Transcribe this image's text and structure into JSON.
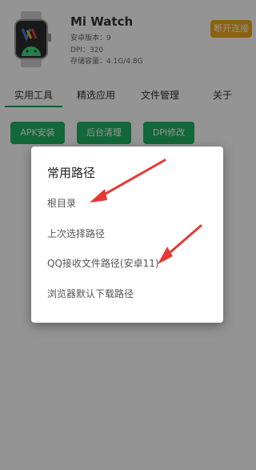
{
  "header": {
    "device_name": "Mi Watch",
    "info": [
      "安卓版本：9",
      "DPI：320",
      "存储容量：4.1G/4.8G"
    ],
    "connect_button": "断开连接"
  },
  "tabs": [
    "实用工具",
    "精选应用",
    "文件管理",
    "关于"
  ],
  "tools": [
    "APK安装",
    "后台清理",
    "DPI修改"
  ],
  "dialog": {
    "title": "常用路径",
    "items": [
      "根目录",
      "上次选择路径",
      "QQ接收文件路径(安卓11)",
      "浏览器默认下载路径"
    ]
  },
  "colors": {
    "accent_green": "#20b463",
    "connect_orange": "#f0a81a",
    "annotation_red": "#e53935"
  }
}
